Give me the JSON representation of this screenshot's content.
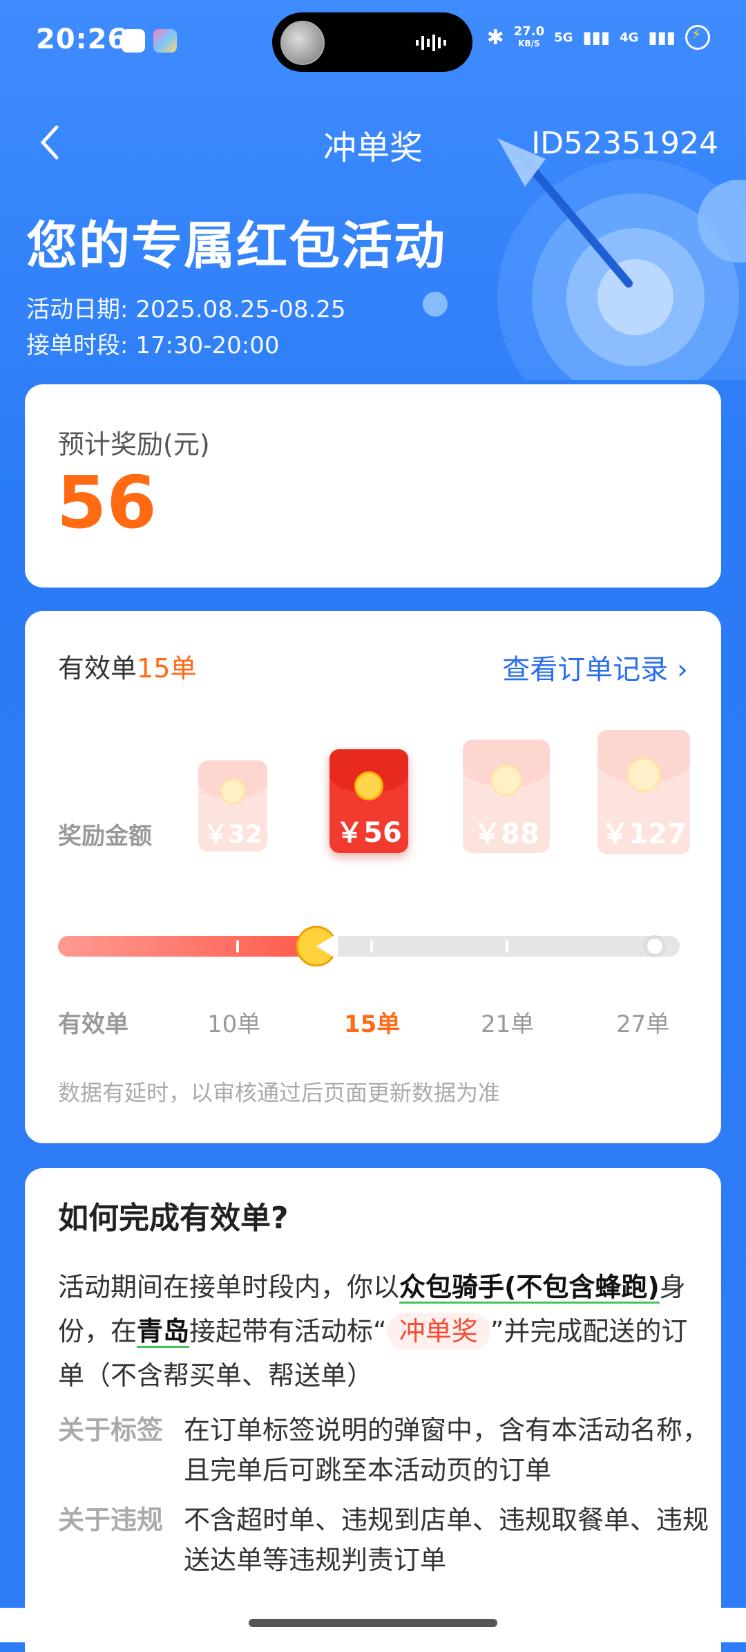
{
  "status_bar": {
    "time": "20:26",
    "net_speed": "27.0",
    "net_unit": "KB/S",
    "sig1": "5G",
    "sig2": "4G"
  },
  "nav": {
    "title": "冲单奖",
    "id": "ID52351924"
  },
  "hero": {
    "headline": "您的专属红包活动",
    "date_label": "活动日期:",
    "date_value": "2025.08.25-08.25",
    "time_label": "接单时段:",
    "time_value": "17:30-20:00"
  },
  "reward": {
    "label": "预计奖励(元)",
    "amount": "56"
  },
  "progress": {
    "valid_prefix": "有效单",
    "valid_count": "15单",
    "record_link": "查看订单记录",
    "reward_label": "奖励金额",
    "tiers": [
      {
        "amount": "￥32",
        "orders": "10单",
        "active": false
      },
      {
        "amount": "￥56",
        "orders": "15单",
        "active": true
      },
      {
        "amount": "￥88",
        "orders": "21单",
        "active": false
      },
      {
        "amount": "￥127",
        "orders": "27单",
        "active": false
      }
    ],
    "axis_label": "有效单",
    "current_orders": 15,
    "note": "数据有延时，以审核通过后页面更新数据为准"
  },
  "howto": {
    "title": "如何完成有效单?",
    "p1": "活动期间在接单时段内，你以",
    "p1_em": "众包骑手(不包含蜂跑)",
    "p2": "身份，在",
    "p2_em": "青岛",
    "p3": "接起带有活动标“",
    "tag": "冲单奖",
    "p4": "”并完成配送的订单（不含帮买单、帮送单）",
    "rows": [
      {
        "k": "关于标签",
        "v": "在订单标签说明的弹窗中，含有本活动名称，且完单后可跳至本活动页的订单"
      },
      {
        "k": "关于违规",
        "v": "不含超时单、违规到店单、违规取餐单、违规送达单等违规判责订单"
      }
    ]
  },
  "colors": {
    "brand_blue": "#2f7df6",
    "accent_orange": "#ff6a13",
    "red": "#f23a2e"
  }
}
